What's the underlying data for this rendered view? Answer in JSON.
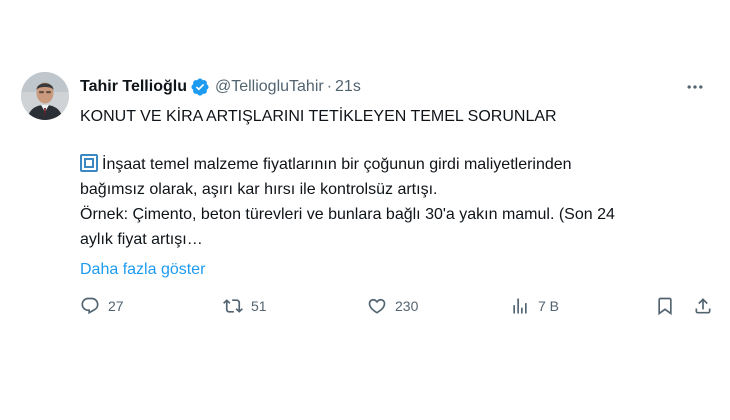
{
  "author": {
    "display_name": "Tahir Tellioğlu",
    "handle": "@TelliogluTahir",
    "separator": "·",
    "time": "21s",
    "verified_icon": "verified-badge-icon",
    "avatar_icon": "profile-avatar"
  },
  "tweet": {
    "headline": "KONUT VE KİRA ARTIŞLARINI TETİKLEYEN TEMEL SORUNLAR",
    "bullet_icon": "checkbox-square-emoji",
    "line1": "İnşaat temel malzeme fiyatlarının bir çoğunun girdi maliyetlerinden",
    "line2": "bağımsız olarak, aşırı kar hırsı ile kontrolsüz artışı.",
    "line3": "Örnek: Çimento, beton türevleri ve bunlara bağlı 30'a yakın mamul. (Son 24",
    "line4": "aylık fiyat artışı…",
    "show_more": "Daha fazla göster"
  },
  "actions": {
    "reply": {
      "icon": "reply-icon",
      "count": "27"
    },
    "retweet": {
      "icon": "retweet-icon",
      "count": "51"
    },
    "like": {
      "icon": "heart-icon",
      "count": "230"
    },
    "views": {
      "icon": "views-chart-icon",
      "count": "7 B"
    },
    "bookmark": {
      "icon": "bookmark-icon"
    },
    "share": {
      "icon": "share-icon"
    },
    "more": {
      "icon": "more-options-icon"
    }
  },
  "colors": {
    "accent": "#1d9bf0",
    "text": "#0f1419",
    "secondary": "#536471"
  }
}
